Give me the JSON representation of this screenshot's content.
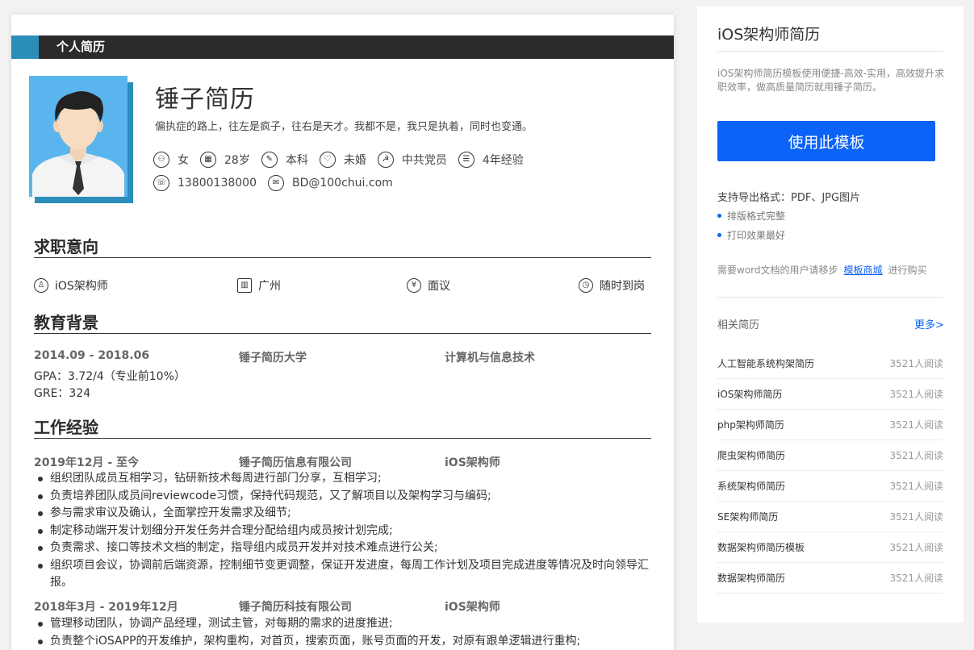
{
  "resume": {
    "header_title": "个人简历",
    "name": "锤子简历",
    "motto": "偏执症的路上，往左是疯子，往右是天才。我都不是，我只是执着，同时也变通。",
    "info": [
      {
        "icon": "gender-icon",
        "glyph": "⚇",
        "value": "女"
      },
      {
        "icon": "age-icon",
        "glyph": "▦",
        "value": "28岁"
      },
      {
        "icon": "education-icon",
        "glyph": "✎",
        "value": "本科"
      },
      {
        "icon": "marriage-icon",
        "glyph": "♡",
        "value": "未婚"
      },
      {
        "icon": "party-icon",
        "glyph": "☭",
        "value": "中共党员"
      },
      {
        "icon": "experience-icon",
        "glyph": "☰",
        "value": "4年经验"
      }
    ],
    "contact": [
      {
        "icon": "phone-icon",
        "glyph": "☏",
        "value": "13800138000"
      },
      {
        "icon": "mail-icon",
        "glyph": "✉",
        "value": "BD@100chui.com"
      }
    ],
    "sections": {
      "intent": "求职意向",
      "education": "教育背景",
      "work": "工作经验"
    },
    "intent": {
      "position": "iOS架构师",
      "city": "广州",
      "salary": "面议",
      "arrival": "随时到岗"
    },
    "education": {
      "period": "2014.09 - 2018.06",
      "school": "锤子简历大学",
      "major": "计算机与信息技术",
      "gpa": "GPA：3.72/4（专业前10%）",
      "gre": "GRE：324"
    },
    "jobs": [
      {
        "period": "2019年12月 - 至今",
        "company": "锤子简历信息有限公司",
        "title": "iOS架构师",
        "duties": [
          "组织团队成员互相学习，钻研新技术每周进行部门分享，互相学习;",
          "负责培养团队成员间reviewcode习惯，保持代码规范，又了解项目以及架构学习与编码;",
          "参与需求审议及确认，全面掌控开发需求及细节;",
          "制定移动端开发计划细分开发任务并合理分配给组内成员按计划完成;",
          "负责需求、接口等技术文档的制定，指导组内成员开发并对技术难点进行公关;",
          "组织项目会议，协调前后端资源，控制细节变更调整，保证开发进度，每周工作计划及项目完成进度等情况及时向领导汇报。"
        ]
      },
      {
        "period": "2018年3月 - 2019年12月",
        "company": "锤子简历科技有限公司",
        "title": "iOS架构师",
        "duties": [
          "管理移动团队，协调产品经理，测试主管，对每期的需求的进度推进;",
          "负责整个iOSAPP的开发维护，架构重构，对首页，搜索页面，账号页面的开发，对原有跟单逻辑进行重构;"
        ]
      }
    ]
  },
  "sidebar": {
    "title": "iOS架构师简历",
    "description": "iOS架构师简历模板使用便捷-高效-实用，高效提升求职效率，做高质量简历就用锤子简历。",
    "use_button": "使用此模板",
    "formats": "支持导出格式：PDF、JPG图片",
    "features": [
      "排版格式完整",
      "打印效果最好"
    ],
    "word_prefix": "需要word文档的用户请移步",
    "word_link": "模板商城",
    "word_suffix": "进行购买",
    "related_title": "相关简历",
    "more": "更多>",
    "related": [
      {
        "name": "人工智能系统构架简历",
        "views": "3521人阅读"
      },
      {
        "name": "iOS架构师简历",
        "views": "3521人阅读"
      },
      {
        "name": "php架构师简历",
        "views": "3521人阅读"
      },
      {
        "name": "爬虫架构师简历",
        "views": "3521人阅读"
      },
      {
        "name": "系统架构师简历",
        "views": "3521人阅读"
      },
      {
        "name": "SE架构师简历",
        "views": "3521人阅读"
      },
      {
        "name": "数据架构师简历模板",
        "views": "3521人阅读"
      },
      {
        "name": "数据架构师简历",
        "views": "3521人阅读"
      }
    ]
  },
  "colors": {
    "accent_blue": "#2b8db9",
    "header_dark": "#2b2b2b",
    "button_blue": "#0a62f6",
    "photo_bg": "#5ab5ee"
  }
}
